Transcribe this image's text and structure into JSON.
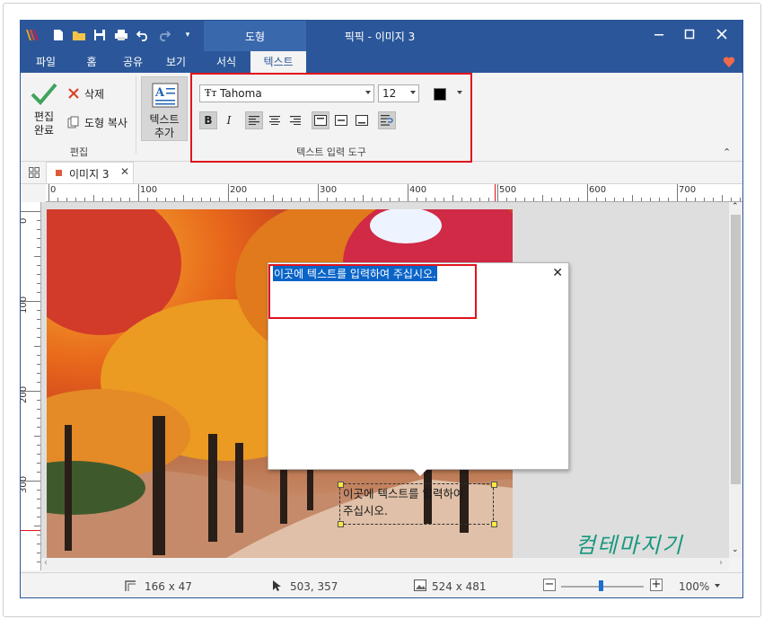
{
  "window": {
    "title": "픽픽 - 이미지 3",
    "context_tab_group": "도형"
  },
  "tabs": [
    {
      "label": "파일"
    },
    {
      "label": "홈"
    },
    {
      "label": "공유"
    },
    {
      "label": "보기"
    },
    {
      "label": "서식"
    },
    {
      "label": "텍스트",
      "active": true
    }
  ],
  "ribbon": {
    "edit_group": {
      "done_label": "편집\n완료",
      "delete_label": "삭제",
      "copy_shape_label": "도형 복사",
      "group_label": "편집"
    },
    "add_text_label": "텍스트\n추가",
    "text_tools": {
      "font_name": "Tahoma",
      "font_size": "12",
      "group_label": "텍스트 입력 도구",
      "bold_label": "B",
      "italic_label": "I"
    }
  },
  "doc_tab": {
    "label": "이미지 3"
  },
  "ruler": {
    "h_ticks": [
      "0",
      "100",
      "200",
      "300",
      "400",
      "500",
      "600",
      "700"
    ],
    "v_ticks": [
      "0",
      "100",
      "200",
      "300"
    ]
  },
  "popup": {
    "text": "이곳에 텍스트를 입력하여 주십시오.",
    "close": "✕"
  },
  "canvas_textbox": {
    "line1": "이곳에 텍스트를 입력하여",
    "line2": "주십시오."
  },
  "watermark": "컴테마지기",
  "status": {
    "shape_size": "166 x 47",
    "cursor_pos": "503, 357",
    "image_size": "524 x 481",
    "zoom": "100%"
  },
  "colors": {
    "titlebar": "#2b579a",
    "highlight_red": "#e0141b",
    "selection": "#0a64c8",
    "watermark": "#16977d"
  }
}
